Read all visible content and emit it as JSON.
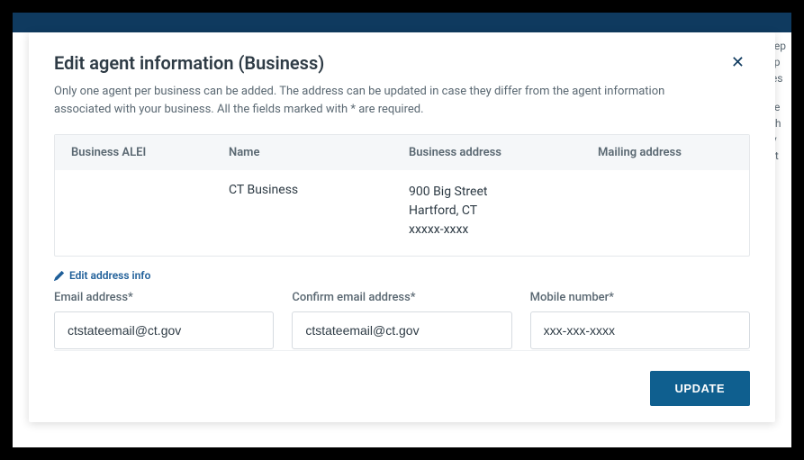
{
  "modal": {
    "title": "Edit agent information (Business)",
    "subtitle": "Only one agent per business can be added. The address can be updated in case they differ from the agent information associated with your business. All the fields marked with * are required.",
    "close_symbol": "✕"
  },
  "table": {
    "headers": {
      "alei": "Business ALEI",
      "name": "Name",
      "business_address": "Business address",
      "mailing_address": "Mailing address"
    },
    "row": {
      "alei": "",
      "name": "CT Business",
      "business_address_line1": "900 Big Street",
      "business_address_line2": "Hartford, CT",
      "business_address_line3": "xxxxx-xxxx",
      "mailing_address": ""
    }
  },
  "edit_link": "Edit address info",
  "form": {
    "email_label": "Email address*",
    "email_value": "ctstateemail@ct.gov",
    "confirm_email_label": "Confirm email address*",
    "confirm_email_value": "ctstateemail@ct.gov",
    "mobile_label": "Mobile number*",
    "mobile_value": "xxx-xxx-xxxx"
  },
  "footer": {
    "update_label": "UPDATE"
  },
  "background": {
    "line1": "ccep",
    "line2": "al p",
    "line3": "ines",
    "line4": "ase",
    "line5": "n th",
    "line6": "ply",
    "line7": "nt t"
  }
}
